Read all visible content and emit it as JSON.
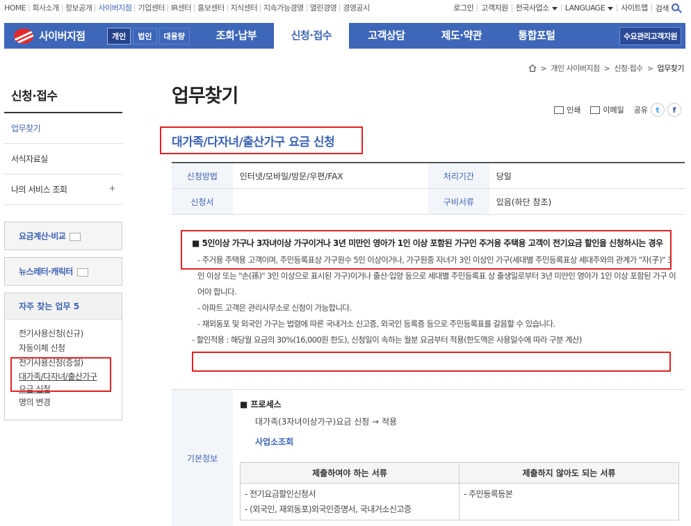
{
  "topbar": {
    "left_links": [
      "HOME",
      "회사소개",
      "정보공개",
      "사이버지점",
      "기업센터",
      "IR센터",
      "홍보센터",
      "지식센터",
      "지속가능경영",
      "열린경영",
      "경영공시"
    ],
    "right_links": [
      "로그인",
      "고객지원",
      "전국사업소",
      "LANGUAGE",
      "사이트맵",
      "검색"
    ]
  },
  "gnb": {
    "logo_text": "사이버지점",
    "segments": [
      "개인",
      "법인",
      "대용량"
    ],
    "menu": [
      "조회·납부",
      "신청·접수",
      "고객상담",
      "제도·약관",
      "통합포털"
    ],
    "cs_button": "수요관리고객지원"
  },
  "breadcrumb": [
    "개인 사이버지점",
    "신청·접수",
    "업무찾기"
  ],
  "sidebar": {
    "title": "신청·접수",
    "items": [
      {
        "label": "업무찾기"
      },
      {
        "label": "서식자료실"
      },
      {
        "label": "나의 서비스 조회",
        "plus": "+"
      }
    ],
    "box1": "요금계산·비교",
    "box2": "뉴스레터·캐릭터",
    "freq_title": "자주 찾는 업무 5",
    "freq_items": [
      "전기사용신청(신규)",
      "자동이체 신청",
      "전기사용신청(증설)",
      "대가족/다자녀/출산가구 요금 신청",
      "명의 변경"
    ]
  },
  "page": {
    "title": "업무찾기",
    "tools": [
      "인쇄",
      "이메일",
      "공유"
    ],
    "subtitle": "대가족/다자녀/출산가구 요금 신청"
  },
  "info": {
    "method_label": "신청방법",
    "method_value": "인터넷/모바일/방문/우편/FAX",
    "period_label": "처리기간",
    "period_value": "당일",
    "form_label": "신청서",
    "form_value": "",
    "docs_label": "구비서류",
    "docs_value": "있음(하단 참조)"
  },
  "detail": {
    "lead": "■ 5인이상 가구나 3자녀이상 가구이거나 3년 미만인 영아가 1인 이상 포함된 가구인 주거용 주택용 고객이 전기요금 할인을 신청하시는 경우",
    "p1": "- 주거용 주택용 고객이며, 주민등록표상 가구원수 5인 이상이거나, 가구원중 자녀가 3인 이상인 가구(세대별 주민등록표상 세대주와의 관계가 \"자(子)\" 3인 이상 또는 \"손(孫)\" 3인 이상으로 표시된 가구)이거나 출산·입양 등으로 세대별 주민등록표 상 출생일로부터 3년 미만인 영아가 1인 이상 포함된 가구 이어야 합니다.",
    "p2": "- 아파트 고객은 관리사무소로 신청이 가능합니다.",
    "p3": "- 재외동포 및 외국인 가구는 법령에 따른 국내거소 신고증, 외국인 등록증 등으로 주민등록표를 갈음할 수 있습니다.",
    "p4": "- 할인적용 : 해당월 요금의 30%(16,000원 한도), 신청일이 속하는 월분 요금부터 적용(한도액은 사용일수에 따라 구분 계산)"
  },
  "basic": {
    "label": "기본정보",
    "process_title": "■ 프로세스",
    "process_flow": "대가족(3자녀이상가구)요금 신청 → 적용",
    "office_link": "사업소조회",
    "doc_head_required": "제출하여야 하는 서류",
    "doc_head_optional": "제출하지 않아도 되는 서류",
    "required": [
      "- 전기요금할인신청서",
      "- (외국인, 재외동포)외국인증명서, 국내거소신고증"
    ],
    "optional": [
      "- 주민등록등본"
    ]
  }
}
